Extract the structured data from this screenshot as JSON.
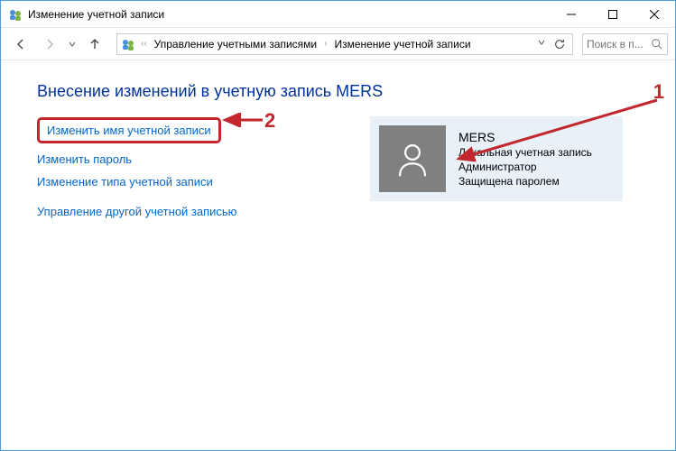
{
  "window": {
    "title": "Изменение учетной записи"
  },
  "breadcrumb": {
    "part1": "Управление учетными записями",
    "part2": "Изменение учетной записи"
  },
  "search": {
    "placeholder": "Поиск в п..."
  },
  "heading": "Внесение изменений в учетную запись MERS",
  "links": {
    "change_name": "Изменить имя учетной записи",
    "change_pw": "Изменить пароль",
    "change_type": "Изменение типа учетной записи",
    "manage_other": "Управление другой учетной записью"
  },
  "account": {
    "name": "MERS",
    "type": "Локальная учетная запись",
    "role": "Администратор",
    "protection": "Защищена паролем"
  },
  "annotations": {
    "one": "1",
    "two": "2"
  }
}
